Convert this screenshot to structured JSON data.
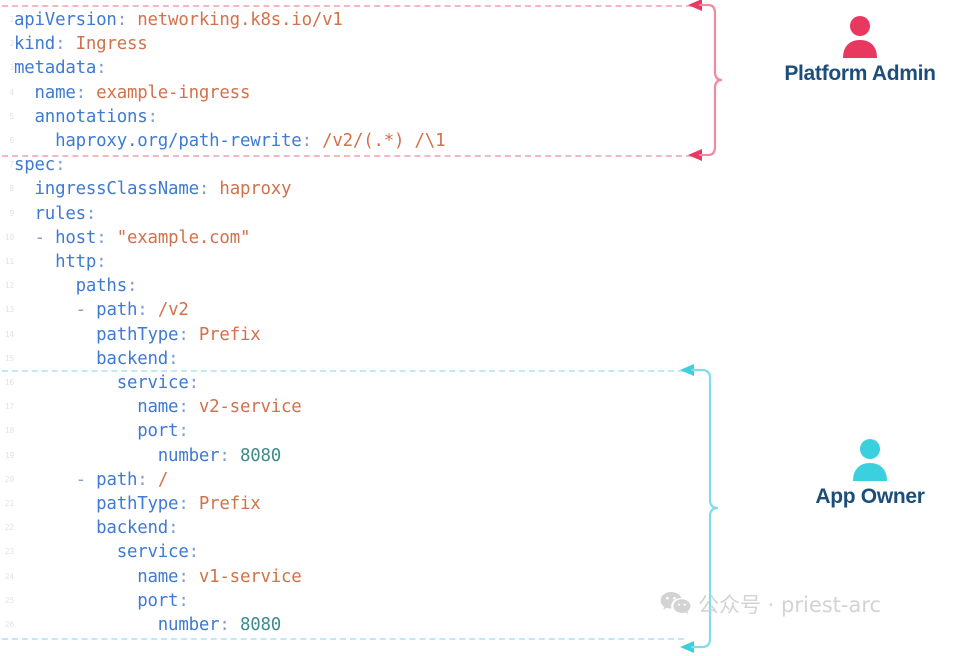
{
  "code": {
    "language": "yaml",
    "lines": [
      {
        "num": "1",
        "tokens": [
          {
            "t": "apiVersion",
            "c": "k"
          },
          {
            "t": ": ",
            "c": "p"
          },
          {
            "t": "networking.k8s.io/v1",
            "c": "s"
          }
        ]
      },
      {
        "num": "2",
        "tokens": [
          {
            "t": "kind",
            "c": "k"
          },
          {
            "t": ": ",
            "c": "p"
          },
          {
            "t": "Ingress",
            "c": "s"
          }
        ]
      },
      {
        "num": "3",
        "tokens": [
          {
            "t": "metadata",
            "c": "k"
          },
          {
            "t": ":",
            "c": "p"
          }
        ]
      },
      {
        "num": "4",
        "tokens": [
          {
            "t": "  name",
            "c": "k"
          },
          {
            "t": ": ",
            "c": "p"
          },
          {
            "t": "example-ingress",
            "c": "s"
          }
        ]
      },
      {
        "num": "5",
        "tokens": [
          {
            "t": "  annotations",
            "c": "k"
          },
          {
            "t": ":",
            "c": "p"
          }
        ]
      },
      {
        "num": "6",
        "tokens": [
          {
            "t": "    haproxy.org/path-rewrite",
            "c": "k"
          },
          {
            "t": ": ",
            "c": "p"
          },
          {
            "t": "/v2/(.*) /\\1",
            "c": "s"
          }
        ]
      },
      {
        "num": "7",
        "tokens": [
          {
            "t": "spec",
            "c": "k"
          },
          {
            "t": ":",
            "c": "p"
          }
        ]
      },
      {
        "num": "8",
        "tokens": [
          {
            "t": "  ingressClassName",
            "c": "k"
          },
          {
            "t": ": ",
            "c": "p"
          },
          {
            "t": "haproxy",
            "c": "s"
          }
        ]
      },
      {
        "num": "9",
        "tokens": [
          {
            "t": "  rules",
            "c": "k"
          },
          {
            "t": ":",
            "c": "p"
          }
        ]
      },
      {
        "num": "10",
        "tokens": [
          {
            "t": "  - ",
            "c": "p"
          },
          {
            "t": "host",
            "c": "k"
          },
          {
            "t": ": ",
            "c": "p"
          },
          {
            "t": "\"example.com\"",
            "c": "s"
          }
        ]
      },
      {
        "num": "11",
        "tokens": [
          {
            "t": "    http",
            "c": "k"
          },
          {
            "t": ":",
            "c": "p"
          }
        ]
      },
      {
        "num": "12",
        "tokens": [
          {
            "t": "      paths",
            "c": "k"
          },
          {
            "t": ":",
            "c": "p"
          }
        ]
      },
      {
        "num": "13",
        "tokens": [
          {
            "t": "      - ",
            "c": "p"
          },
          {
            "t": "path",
            "c": "k"
          },
          {
            "t": ": ",
            "c": "p"
          },
          {
            "t": "/v2",
            "c": "s"
          }
        ]
      },
      {
        "num": "14",
        "tokens": [
          {
            "t": "        pathType",
            "c": "k"
          },
          {
            "t": ": ",
            "c": "p"
          },
          {
            "t": "Prefix",
            "c": "s"
          }
        ]
      },
      {
        "num": "15",
        "tokens": [
          {
            "t": "        backend",
            "c": "k"
          },
          {
            "t": ":",
            "c": "p"
          }
        ]
      },
      {
        "num": "16",
        "tokens": [
          {
            "t": "          service",
            "c": "k"
          },
          {
            "t": ":",
            "c": "p"
          }
        ]
      },
      {
        "num": "17",
        "tokens": [
          {
            "t": "            name",
            "c": "k"
          },
          {
            "t": ": ",
            "c": "p"
          },
          {
            "t": "v2-service",
            "c": "s"
          }
        ]
      },
      {
        "num": "18",
        "tokens": [
          {
            "t": "            port",
            "c": "k"
          },
          {
            "t": ":",
            "c": "p"
          }
        ]
      },
      {
        "num": "19",
        "tokens": [
          {
            "t": "              number",
            "c": "k"
          },
          {
            "t": ": ",
            "c": "p"
          },
          {
            "t": "8080",
            "c": "n"
          }
        ]
      },
      {
        "num": "20",
        "tokens": [
          {
            "t": "      - ",
            "c": "p"
          },
          {
            "t": "path",
            "c": "k"
          },
          {
            "t": ": ",
            "c": "p"
          },
          {
            "t": "/",
            "c": "s"
          }
        ]
      },
      {
        "num": "21",
        "tokens": [
          {
            "t": "        pathType",
            "c": "k"
          },
          {
            "t": ": ",
            "c": "p"
          },
          {
            "t": "Prefix",
            "c": "s"
          }
        ]
      },
      {
        "num": "22",
        "tokens": [
          {
            "t": "        backend",
            "c": "k"
          },
          {
            "t": ":",
            "c": "p"
          }
        ]
      },
      {
        "num": "23",
        "tokens": [
          {
            "t": "          service",
            "c": "k"
          },
          {
            "t": ":",
            "c": "p"
          }
        ]
      },
      {
        "num": "24",
        "tokens": [
          {
            "t": "            name",
            "c": "k"
          },
          {
            "t": ": ",
            "c": "p"
          },
          {
            "t": "v1-service",
            "c": "s"
          }
        ]
      },
      {
        "num": "25",
        "tokens": [
          {
            "t": "            port",
            "c": "k"
          },
          {
            "t": ":",
            "c": "p"
          }
        ]
      },
      {
        "num": "26",
        "tokens": [
          {
            "t": "              number",
            "c": "k"
          },
          {
            "t": ": ",
            "c": "p"
          },
          {
            "t": "8080",
            "c": "n"
          }
        ]
      }
    ]
  },
  "annotations": [
    {
      "id": "platform-admin",
      "label": "Platform Admin",
      "color": "#e8385f",
      "brace_color": "#f08aa0",
      "dash_color": "#f5b6c4",
      "icon": "person-icon"
    },
    {
      "id": "app-owner",
      "label": "App Owner",
      "color": "#3ad0de",
      "brace_color": "#7fdce8",
      "dash_color": "#bfeaf2",
      "icon": "person-icon"
    }
  ],
  "watermark": {
    "icon": "wechat-icon",
    "text": "公众号 · priest-arc",
    "color": "#d3d3d3"
  },
  "colors": {
    "background": "#ffffff",
    "yaml_key": "#3f7ad4",
    "yaml_string": "#d2724a",
    "yaml_number": "#3d8b8b",
    "label_text": "#1d4e79"
  }
}
